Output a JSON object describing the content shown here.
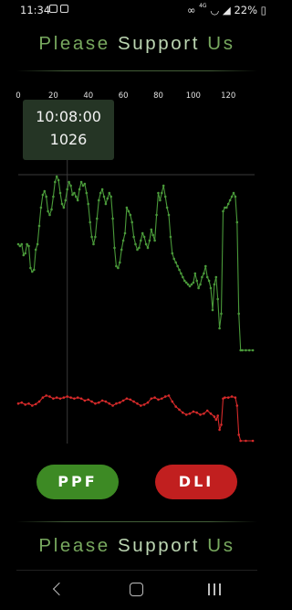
{
  "status_bar": {
    "time": "11:34",
    "battery": "22%",
    "signal_label": "4G",
    "icons": [
      "image-icon",
      "check-box-icon",
      "link-icon",
      "wifi-icon",
      "signal-icon",
      "battery-icon"
    ]
  },
  "banner": {
    "word1": "Please",
    "word2": "Support",
    "word3": "Us"
  },
  "tooltip": {
    "time": "10:08:00",
    "value": "1026"
  },
  "buttons": {
    "ppf_label": "PPF",
    "dli_label": "DLI"
  },
  "colors": {
    "ppf": "#3d8a24",
    "dli": "#c11f1f",
    "ppf_line": "#4a9a3a",
    "dli_line": "#d62a2a",
    "tooltip_bg": "#253525"
  },
  "chart_data": {
    "type": "line",
    "x_ticks": [
      "0",
      "20",
      "40",
      "60",
      "80",
      "100",
      "120"
    ],
    "xlim": [
      0,
      135
    ],
    "crosshair_x": 28,
    "series": [
      {
        "values": [
          {
            "x": 0,
            "y": 0.58
          },
          {
            "x": 1,
            "y": 0.57
          },
          {
            "x": 2,
            "y": 0.58
          },
          {
            "x": 3,
            "y": 0.52
          },
          {
            "x": 4,
            "y": 0.53
          },
          {
            "x": 5,
            "y": 0.58
          },
          {
            "x": 6,
            "y": 0.57
          },
          {
            "x": 7,
            "y": 0.45
          },
          {
            "x": 8,
            "y": 0.43
          },
          {
            "x": 9,
            "y": 0.44
          },
          {
            "x": 10,
            "y": 0.55
          },
          {
            "x": 11,
            "y": 0.58
          },
          {
            "x": 12,
            "y": 0.68
          },
          {
            "x": 13,
            "y": 0.78
          },
          {
            "x": 14,
            "y": 0.85
          },
          {
            "x": 15,
            "y": 0.87
          },
          {
            "x": 16,
            "y": 0.84
          },
          {
            "x": 17,
            "y": 0.76
          },
          {
            "x": 18,
            "y": 0.74
          },
          {
            "x": 19,
            "y": 0.77
          },
          {
            "x": 20,
            "y": 0.84
          },
          {
            "x": 21,
            "y": 0.92
          },
          {
            "x": 22,
            "y": 0.95
          },
          {
            "x": 23,
            "y": 0.93
          },
          {
            "x": 24,
            "y": 0.86
          },
          {
            "x": 25,
            "y": 0.8
          },
          {
            "x": 26,
            "y": 0.78
          },
          {
            "x": 27,
            "y": 0.82
          },
          {
            "x": 28,
            "y": 0.88
          },
          {
            "x": 29,
            "y": 0.92
          },
          {
            "x": 30,
            "y": 0.9
          },
          {
            "x": 31,
            "y": 0.85
          },
          {
            "x": 32,
            "y": 0.86
          },
          {
            "x": 33,
            "y": 0.84
          },
          {
            "x": 34,
            "y": 0.82
          },
          {
            "x": 35,
            "y": 0.88
          },
          {
            "x": 36,
            "y": 0.92
          },
          {
            "x": 37,
            "y": 0.9
          },
          {
            "x": 38,
            "y": 0.91
          },
          {
            "x": 39,
            "y": 0.86
          },
          {
            "x": 40,
            "y": 0.8
          },
          {
            "x": 41,
            "y": 0.7
          },
          {
            "x": 42,
            "y": 0.62
          },
          {
            "x": 43,
            "y": 0.58
          },
          {
            "x": 44,
            "y": 0.62
          },
          {
            "x": 45,
            "y": 0.72
          },
          {
            "x": 46,
            "y": 0.82
          },
          {
            "x": 47,
            "y": 0.86
          },
          {
            "x": 48,
            "y": 0.88
          },
          {
            "x": 49,
            "y": 0.84
          },
          {
            "x": 50,
            "y": 0.8
          },
          {
            "x": 51,
            "y": 0.83
          },
          {
            "x": 52,
            "y": 0.86
          },
          {
            "x": 53,
            "y": 0.84
          },
          {
            "x": 54,
            "y": 0.72
          },
          {
            "x": 55,
            "y": 0.56
          },
          {
            "x": 56,
            "y": 0.46
          },
          {
            "x": 57,
            "y": 0.45
          },
          {
            "x": 58,
            "y": 0.48
          },
          {
            "x": 59,
            "y": 0.55
          },
          {
            "x": 60,
            "y": 0.6
          },
          {
            "x": 61,
            "y": 0.64
          },
          {
            "x": 62,
            "y": 0.78
          },
          {
            "x": 63,
            "y": 0.76
          },
          {
            "x": 64,
            "y": 0.74
          },
          {
            "x": 65,
            "y": 0.7
          },
          {
            "x": 66,
            "y": 0.62
          },
          {
            "x": 67,
            "y": 0.58
          },
          {
            "x": 68,
            "y": 0.55
          },
          {
            "x": 69,
            "y": 0.56
          },
          {
            "x": 70,
            "y": 0.6
          },
          {
            "x": 71,
            "y": 0.64
          },
          {
            "x": 72,
            "y": 0.62
          },
          {
            "x": 73,
            "y": 0.58
          },
          {
            "x": 74,
            "y": 0.56
          },
          {
            "x": 75,
            "y": 0.6
          },
          {
            "x": 76,
            "y": 0.66
          },
          {
            "x": 77,
            "y": 0.63
          },
          {
            "x": 78,
            "y": 0.6
          },
          {
            "x": 79,
            "y": 0.74
          },
          {
            "x": 80,
            "y": 0.86
          },
          {
            "x": 81,
            "y": 0.82
          },
          {
            "x": 82,
            "y": 0.86
          },
          {
            "x": 83,
            "y": 0.9
          },
          {
            "x": 84,
            "y": 0.84
          },
          {
            "x": 85,
            "y": 0.78
          },
          {
            "x": 86,
            "y": 0.74
          },
          {
            "x": 87,
            "y": 0.62
          },
          {
            "x": 88,
            "y": 0.53
          },
          {
            "x": 89,
            "y": 0.5
          },
          {
            "x": 90,
            "y": 0.48
          },
          {
            "x": 91,
            "y": 0.46
          },
          {
            "x": 92,
            "y": 0.44
          },
          {
            "x": 93,
            "y": 0.42
          },
          {
            "x": 94,
            "y": 0.4
          },
          {
            "x": 95,
            "y": 0.38
          },
          {
            "x": 96,
            "y": 0.37
          },
          {
            "x": 97,
            "y": 0.36
          },
          {
            "x": 98,
            "y": 0.35
          },
          {
            "x": 99,
            "y": 0.36
          },
          {
            "x": 100,
            "y": 0.37
          },
          {
            "x": 101,
            "y": 0.42
          },
          {
            "x": 102,
            "y": 0.38
          },
          {
            "x": 103,
            "y": 0.34
          },
          {
            "x": 104,
            "y": 0.36
          },
          {
            "x": 105,
            "y": 0.4
          },
          {
            "x": 106,
            "y": 0.42
          },
          {
            "x": 107,
            "y": 0.46
          },
          {
            "x": 108,
            "y": 0.4
          },
          {
            "x": 109,
            "y": 0.38
          },
          {
            "x": 110,
            "y": 0.34
          },
          {
            "x": 111,
            "y": 0.22
          },
          {
            "x": 112,
            "y": 0.36
          },
          {
            "x": 113,
            "y": 0.4
          },
          {
            "x": 114,
            "y": 0.28
          },
          {
            "x": 115,
            "y": 0.12
          },
          {
            "x": 116,
            "y": 0.2
          },
          {
            "x": 117,
            "y": 0.76
          },
          {
            "x": 118,
            "y": 0.78
          },
          {
            "x": 119,
            "y": 0.78
          },
          {
            "x": 120,
            "y": 0.8
          },
          {
            "x": 121,
            "y": 0.82
          },
          {
            "x": 122,
            "y": 0.84
          },
          {
            "x": 123,
            "y": 0.86
          },
          {
            "x": 124,
            "y": 0.84
          },
          {
            "x": 125,
            "y": 0.7
          },
          {
            "x": 126,
            "y": 0.2
          },
          {
            "x": 127,
            "y": 0.0
          },
          {
            "x": 128,
            "y": 0.0
          },
          {
            "x": 130,
            "y": 0.0
          },
          {
            "x": 132,
            "y": 0.0
          },
          {
            "x": 134,
            "y": 0.0
          }
        ]
      },
      {
        "values": [
          {
            "x": 0,
            "y": 0.74
          },
          {
            "x": 2,
            "y": 0.76
          },
          {
            "x": 4,
            "y": 0.72
          },
          {
            "x": 6,
            "y": 0.74
          },
          {
            "x": 8,
            "y": 0.7
          },
          {
            "x": 10,
            "y": 0.73
          },
          {
            "x": 12,
            "y": 0.78
          },
          {
            "x": 14,
            "y": 0.86
          },
          {
            "x": 16,
            "y": 0.9
          },
          {
            "x": 18,
            "y": 0.88
          },
          {
            "x": 20,
            "y": 0.84
          },
          {
            "x": 22,
            "y": 0.86
          },
          {
            "x": 24,
            "y": 0.84
          },
          {
            "x": 26,
            "y": 0.86
          },
          {
            "x": 28,
            "y": 0.88
          },
          {
            "x": 30,
            "y": 0.86
          },
          {
            "x": 32,
            "y": 0.84
          },
          {
            "x": 34,
            "y": 0.86
          },
          {
            "x": 36,
            "y": 0.84
          },
          {
            "x": 38,
            "y": 0.8
          },
          {
            "x": 40,
            "y": 0.82
          },
          {
            "x": 42,
            "y": 0.78
          },
          {
            "x": 44,
            "y": 0.74
          },
          {
            "x": 46,
            "y": 0.76
          },
          {
            "x": 48,
            "y": 0.8
          },
          {
            "x": 50,
            "y": 0.78
          },
          {
            "x": 52,
            "y": 0.74
          },
          {
            "x": 54,
            "y": 0.7
          },
          {
            "x": 56,
            "y": 0.74
          },
          {
            "x": 58,
            "y": 0.76
          },
          {
            "x": 60,
            "y": 0.8
          },
          {
            "x": 62,
            "y": 0.84
          },
          {
            "x": 64,
            "y": 0.82
          },
          {
            "x": 66,
            "y": 0.78
          },
          {
            "x": 68,
            "y": 0.74
          },
          {
            "x": 70,
            "y": 0.7
          },
          {
            "x": 72,
            "y": 0.72
          },
          {
            "x": 74,
            "y": 0.76
          },
          {
            "x": 76,
            "y": 0.84
          },
          {
            "x": 78,
            "y": 0.86
          },
          {
            "x": 80,
            "y": 0.82
          },
          {
            "x": 82,
            "y": 0.84
          },
          {
            "x": 84,
            "y": 0.88
          },
          {
            "x": 86,
            "y": 0.9
          },
          {
            "x": 88,
            "y": 0.78
          },
          {
            "x": 90,
            "y": 0.68
          },
          {
            "x": 92,
            "y": 0.62
          },
          {
            "x": 94,
            "y": 0.56
          },
          {
            "x": 96,
            "y": 0.52
          },
          {
            "x": 98,
            "y": 0.54
          },
          {
            "x": 100,
            "y": 0.58
          },
          {
            "x": 102,
            "y": 0.56
          },
          {
            "x": 104,
            "y": 0.52
          },
          {
            "x": 106,
            "y": 0.54
          },
          {
            "x": 108,
            "y": 0.6
          },
          {
            "x": 110,
            "y": 0.54
          },
          {
            "x": 112,
            "y": 0.48
          },
          {
            "x": 113,
            "y": 0.42
          },
          {
            "x": 114,
            "y": 0.5
          },
          {
            "x": 115,
            "y": 0.22
          },
          {
            "x": 116,
            "y": 0.32
          },
          {
            "x": 117,
            "y": 0.84
          },
          {
            "x": 118,
            "y": 0.86
          },
          {
            "x": 120,
            "y": 0.86
          },
          {
            "x": 122,
            "y": 0.88
          },
          {
            "x": 124,
            "y": 0.86
          },
          {
            "x": 125,
            "y": 0.7
          },
          {
            "x": 126,
            "y": 0.12
          },
          {
            "x": 127,
            "y": 0.0
          },
          {
            "x": 130,
            "y": 0.0
          },
          {
            "x": 134,
            "y": 0.0
          }
        ]
      }
    ]
  }
}
